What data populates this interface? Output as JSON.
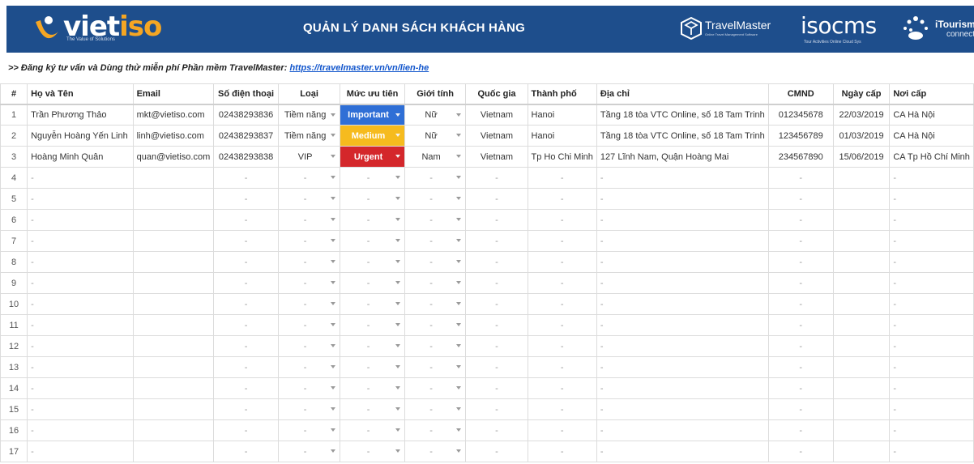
{
  "header": {
    "title": "QUẢN LÝ DANH SÁCH KHÁCH HÀNG",
    "vietiso_word_a": "viet",
    "vietiso_word_b": "iso",
    "vietiso_tagline": "The Value of Solutions",
    "travelmaster_word": "TravelMaster",
    "travelmaster_tagline": "Online Travel Management Software",
    "isocms_word": "isocms",
    "isocms_tagline": "Tour Activities Online Cloud Sys",
    "itourism_word": "iTourism",
    "itourism_sub": "connect"
  },
  "promo": {
    "text": ">> Đăng ký tư vấn và Dùng thử miễn phí Phần mềm TravelMaster: ",
    "link": "https://travelmaster.vn/vn/lien-he"
  },
  "columns": [
    "#",
    "Họ và Tên",
    "Email",
    "Số điện thoại",
    "Loại",
    "Mức ưu tiên",
    "Giới tính",
    "Quốc gia",
    "Thành phố",
    "Địa chỉ",
    "CMND",
    "Ngày cấp",
    "Nơi cấp"
  ],
  "rows": [
    {
      "n": "1",
      "name": "Trần Phương Thảo",
      "email": "mkt@vietiso.com",
      "phone": "02438293836",
      "type": "Tiềm năng",
      "priority": "Important",
      "priority_key": "important",
      "gender": "Nữ",
      "country": "Vietnam",
      "city": "Hanoi",
      "address": "Tầng 18 tòa VTC Online, số 18 Tam Trinh",
      "id": "012345678",
      "issued": "22/03/2019",
      "place": "CA Hà Nội"
    },
    {
      "n": "2",
      "name": "Nguyễn Hoàng Yến Linh",
      "email": "linh@vietiso.com",
      "phone": "02438293837",
      "type": "Tiềm năng",
      "priority": "Medium",
      "priority_key": "medium",
      "gender": "Nữ",
      "country": "Vietnam",
      "city": "Hanoi",
      "address": "Tầng 18 tòa VTC Online, số 18 Tam Trinh",
      "id": "123456789",
      "issued": "01/03/2019",
      "place": "CA Hà Nội"
    },
    {
      "n": "3",
      "name": "Hoàng Minh Quân",
      "email": "quan@vietiso.com",
      "phone": "02438293838",
      "type": "VIP",
      "priority": "Urgent",
      "priority_key": "urgent",
      "gender": "Nam",
      "country": "Vietnam",
      "city": "Tp Ho Chi Minh",
      "address": "127 Lĩnh Nam, Quận Hoàng Mai",
      "id": "234567890",
      "issued": "15/06/2019",
      "place": "CA Tp Hồ Chí Minh"
    }
  ],
  "empty_rows": [
    "4",
    "5",
    "6",
    "7",
    "8",
    "9",
    "10",
    "11",
    "12",
    "13",
    "14",
    "15",
    "16",
    "17"
  ],
  "empty_cell": "-",
  "colors": {
    "banner": "#1e4e8c",
    "important": "#2f6fd6",
    "medium": "#f6bb1e",
    "urgent": "#d4272b",
    "link": "#1155cc"
  }
}
